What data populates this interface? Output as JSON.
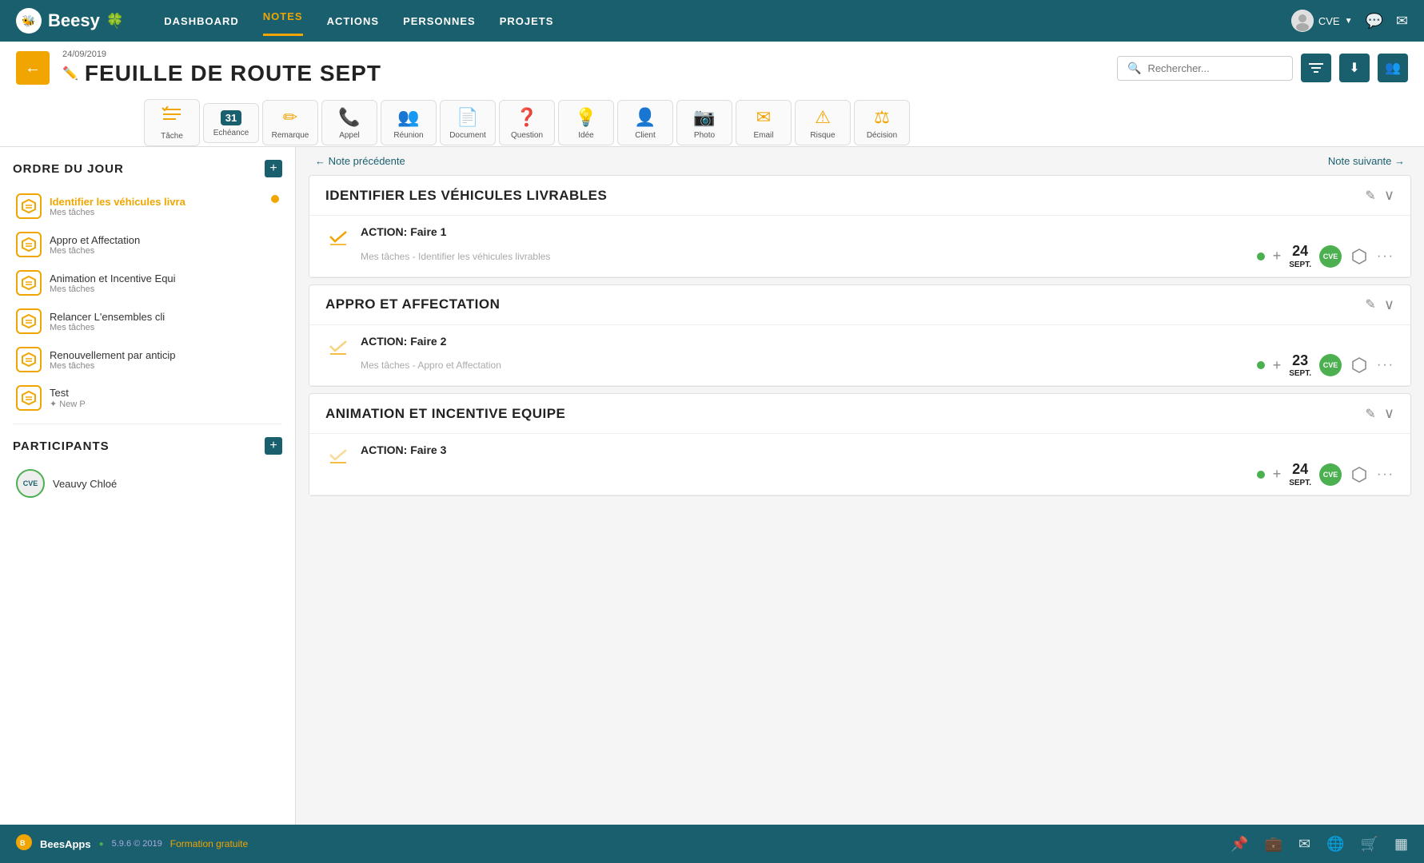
{
  "app": {
    "name": "Beesy"
  },
  "nav": {
    "items": [
      {
        "label": "DASHBOARD",
        "active": false
      },
      {
        "label": "NOTES",
        "active": true
      },
      {
        "label": "ACTIONS",
        "active": false
      },
      {
        "label": "PERSONNES",
        "active": false
      },
      {
        "label": "PROJETS",
        "active": false
      }
    ],
    "user": "CVE",
    "search_placeholder": "Rechercher..."
  },
  "header": {
    "date": "24/09/2019",
    "title": "FEUILLE DE ROUTE SEPT",
    "back_label": "←"
  },
  "toolbar": {
    "items": [
      {
        "icon": "☰",
        "label": "Tâche",
        "type": "icon"
      },
      {
        "icon": "31",
        "label": "Echéance",
        "type": "badge"
      },
      {
        "icon": "✏️",
        "label": "Remarque",
        "type": "icon"
      },
      {
        "icon": "📞",
        "label": "Appel",
        "type": "icon"
      },
      {
        "icon": "👥",
        "label": "Réunion",
        "type": "icon"
      },
      {
        "icon": "📄",
        "label": "Document",
        "type": "icon"
      },
      {
        "icon": "❓",
        "label": "Question",
        "type": "icon"
      },
      {
        "icon": "💡",
        "label": "Idée",
        "type": "icon"
      },
      {
        "icon": "👤",
        "label": "Client",
        "type": "icon"
      },
      {
        "icon": "📷",
        "label": "Photo",
        "type": "icon"
      },
      {
        "icon": "✉️",
        "label": "Email",
        "type": "icon"
      },
      {
        "icon": "⚠️",
        "label": "Risque",
        "type": "icon"
      },
      {
        "icon": "⚖️",
        "label": "Décision",
        "type": "icon"
      }
    ]
  },
  "sidebar": {
    "agenda_title": "ORDRE DU JOUR",
    "items": [
      {
        "title": "Identifier les véhicules livra",
        "subtitle": "Mes tâches",
        "active": true,
        "dot": true
      },
      {
        "title": "Appro et Affectation",
        "subtitle": "Mes tâches",
        "active": false,
        "dot": false
      },
      {
        "title": "Animation et Incentive Equi",
        "subtitle": "Mes tâches",
        "active": false,
        "dot": false
      },
      {
        "title": "Relancer L'ensembles cli",
        "subtitle": "Mes tâches",
        "active": false,
        "dot": false
      },
      {
        "title": "Renouvellement par anticip",
        "subtitle": "Mes tâches",
        "active": false,
        "dot": false
      },
      {
        "title": "Test",
        "subtitle": "New P",
        "active": false,
        "dot": false,
        "project": true
      }
    ],
    "participants_title": "PARTICIPANTS",
    "participants": [
      {
        "name": "Veauvy Chloé",
        "initials": "CVE"
      }
    ]
  },
  "content": {
    "prev_label": "← Note précédente",
    "next_label": "Note suivante →",
    "sections": [
      {
        "title": "IDENTIFIER LES VÉHICULES LIVRABLES",
        "actions": [
          {
            "title": "ACTION: Faire 1",
            "tags": "Mes tâches - Identifier les véhicules livrables",
            "date_day": "24",
            "date_month": "SEPT.",
            "avatar": "CVE"
          }
        ]
      },
      {
        "title": "APPRO ET AFFECTATION",
        "actions": [
          {
            "title": "ACTION: Faire 2",
            "tags": "Mes tâches - Appro et Affectation",
            "date_day": "23",
            "date_month": "SEPT.",
            "avatar": "CVE"
          }
        ]
      },
      {
        "title": "ANIMATION ET INCENTIVE EQUIPE",
        "actions": [
          {
            "title": "ACTION: Faire 3",
            "tags": "",
            "date_day": "24",
            "date_month": "SEPT.",
            "avatar": "CVE"
          }
        ]
      }
    ]
  },
  "footer": {
    "app_name": "BeesApps",
    "version": "5.9.6 © 2019",
    "link": "Formation gratuite"
  }
}
